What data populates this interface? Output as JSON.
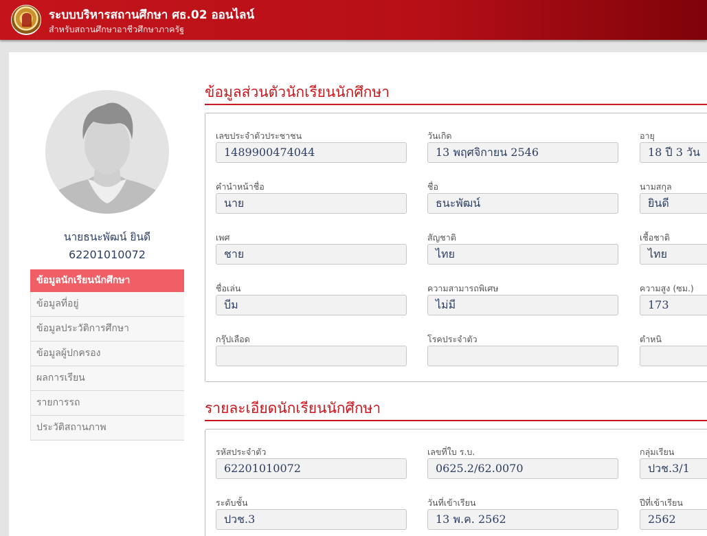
{
  "header": {
    "title": "ระบบบริหารสถานศึกษา ศธ.02 ออนไลน์",
    "subtitle": "สำหรับสถานศึกษาอาชีวศึกษาภาครัฐ"
  },
  "student": {
    "name": "นายธนะพัฒน์ ยินดี",
    "id": "62201010072"
  },
  "sidebar": {
    "items": [
      {
        "label": "ข้อมูลนักเรียนนักศึกษา",
        "active": true
      },
      {
        "label": "ข้อมูลที่อยู่"
      },
      {
        "label": "ข้อมูลประวัติการศึกษา"
      },
      {
        "label": "ข้อมูลผู้ปกครอง"
      },
      {
        "label": "ผลการเรียน"
      },
      {
        "label": "รายการรถ"
      },
      {
        "label": "ประวัติสถานภาพ"
      }
    ]
  },
  "personal": {
    "heading": "ข้อมูลส่วนตัวนักเรียนนักศึกษา",
    "fields": {
      "national_id": {
        "label": "เลขประจำตัวประชาชน",
        "value": "1489900474044"
      },
      "birth_date": {
        "label": "วันเกิด",
        "value": "13 พฤศจิกายน 2546"
      },
      "age": {
        "label": "อายุ",
        "value": "18 ปี 3 วัน"
      },
      "prefix": {
        "label": "คำนำหน้าชื่อ",
        "value": "นาย"
      },
      "first_name": {
        "label": "ชื่อ",
        "value": "ธนะพัฒน์"
      },
      "last_name": {
        "label": "นามสกุล",
        "value": "ยินดี"
      },
      "gender": {
        "label": "เพศ",
        "value": "ชาย"
      },
      "nationality": {
        "label": "สัญชาติ",
        "value": "ไทย"
      },
      "ethnicity": {
        "label": "เชื้อชาติ",
        "value": "ไทย"
      },
      "nickname": {
        "label": "ชื่อเล่น",
        "value": "บีม"
      },
      "special_ability": {
        "label": "ความสามารถพิเศษ",
        "value": "ไม่มี"
      },
      "height": {
        "label": "ความสูง (ซม.)",
        "value": "173"
      },
      "blood_group": {
        "label": "กรุ๊ปเลือด",
        "value": ""
      },
      "chronic_disease": {
        "label": "โรคประจำตัว",
        "value": ""
      },
      "flaw": {
        "label": "ตำหนิ",
        "value": ""
      }
    }
  },
  "details": {
    "heading": "รายละเอียดนักเรียนนักศึกษา",
    "fields": {
      "student_code": {
        "label": "รหัสประจำตัว",
        "value": "62201010072"
      },
      "rb_number": {
        "label": "เลขที่ใบ ร.บ.",
        "value": "0625.2/62.0070"
      },
      "class_group": {
        "label": "กลุ่มเรียน",
        "value": "ปวช.3/1"
      },
      "level": {
        "label": "ระดับชั้น",
        "value": "ปวช.3"
      },
      "enroll_date": {
        "label": "วันที่เข้าเรียน",
        "value": "13 พ.ค. 2562"
      },
      "enroll_year": {
        "label": "ปีที่เข้าเรียน",
        "value": "2562"
      }
    }
  }
}
